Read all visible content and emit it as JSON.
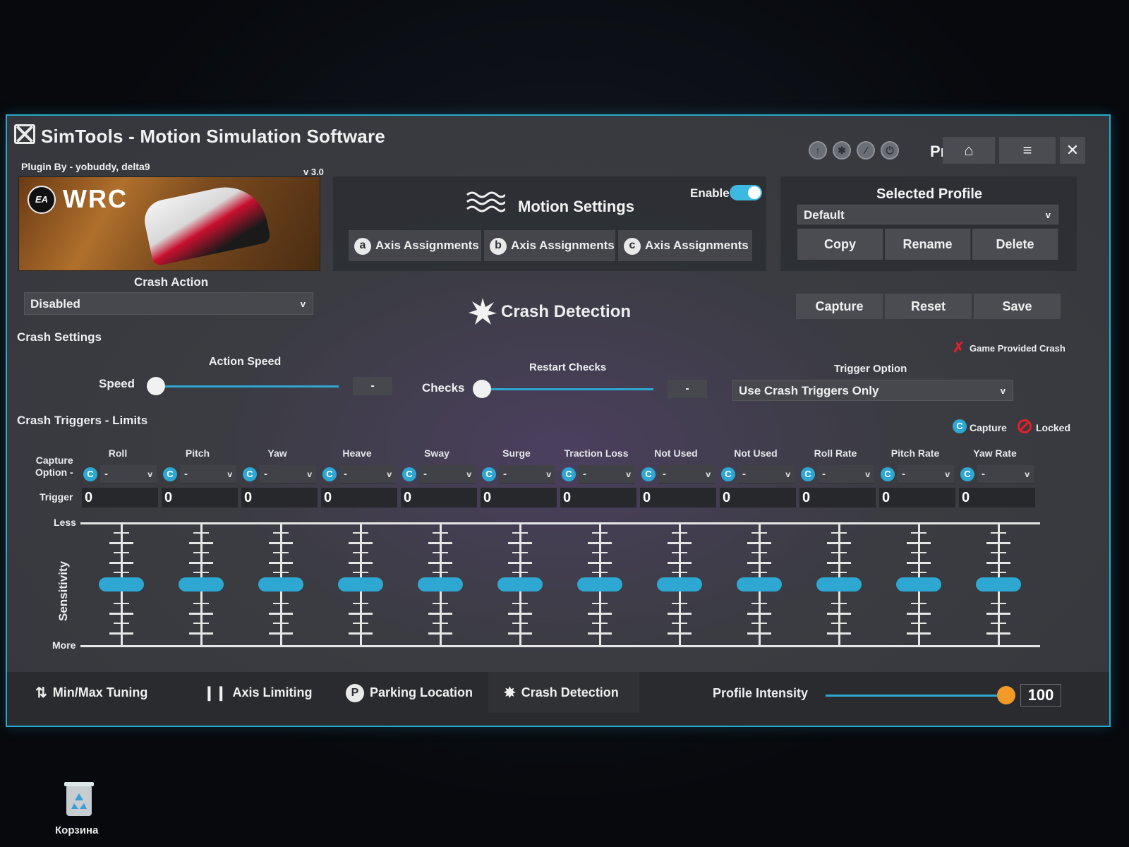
{
  "window": {
    "title": "SimTools - Motion Simulation Software",
    "plugin_by": "Plugin By - yobuddy, delta9",
    "version": "v 3.0",
    "pro_label": "Pro",
    "banner": {
      "ea": "EA",
      "logo": "WRC"
    },
    "titlebar_icons": [
      "arrow-up-icon",
      "gear-icon",
      "wrench-icon",
      "power-icon"
    ],
    "accent_color": "#2ea8d3"
  },
  "motion": {
    "title": "Motion Settings",
    "enable_label": "Enable",
    "enabled": true,
    "tabs": [
      {
        "letter": "a",
        "label": "Axis Assignments"
      },
      {
        "letter": "b",
        "label": "Axis Assignments"
      },
      {
        "letter": "c",
        "label": "Axis Assignments"
      }
    ]
  },
  "profile": {
    "title": "Selected Profile",
    "selected": "Default",
    "buttons": [
      "Copy",
      "Rename",
      "Delete"
    ]
  },
  "crash_action": {
    "label": "Crash Action",
    "value": "Disabled"
  },
  "crash_detection": {
    "title": "Crash Detection",
    "buttons": [
      "Capture",
      "Reset",
      "Save"
    ]
  },
  "crash_settings": {
    "title": "Crash Settings",
    "game_provided": "Game Provided Crash",
    "action_speed_label": "Action Speed",
    "speed_label": "Speed",
    "speed_value": "-",
    "restart_checks_label": "Restart Checks",
    "checks_label": "Checks",
    "checks_value": "-",
    "trigger_option_label": "Trigger Option",
    "trigger_option_value": "Use Crash Triggers Only"
  },
  "crash_triggers": {
    "title": "Crash Triggers - Limits",
    "capture_legend": "Capture",
    "locked_legend": "Locked",
    "capture_option_label": "Capture\nOption -",
    "capture_option_line1": "Capture",
    "capture_option_line2": "Option -",
    "trigger_label": "Trigger",
    "less_label": "Less",
    "more_label": "More",
    "sensitivity_label": "Sensitivity",
    "columns": [
      {
        "name": "Roll",
        "option": "-",
        "trigger": "0"
      },
      {
        "name": "Pitch",
        "option": "-",
        "trigger": "0"
      },
      {
        "name": "Yaw",
        "option": "-",
        "trigger": "0"
      },
      {
        "name": "Heave",
        "option": "-",
        "trigger": "0"
      },
      {
        "name": "Sway",
        "option": "-",
        "trigger": "0"
      },
      {
        "name": "Surge",
        "option": "-",
        "trigger": "0"
      },
      {
        "name": "Traction Loss",
        "option": "-",
        "trigger": "0"
      },
      {
        "name": "Not Used",
        "option": "-",
        "trigger": "0"
      },
      {
        "name": "Not Used",
        "option": "-",
        "trigger": "0"
      },
      {
        "name": "Roll Rate",
        "option": "-",
        "trigger": "0"
      },
      {
        "name": "Pitch Rate",
        "option": "-",
        "trigger": "0"
      },
      {
        "name": "Yaw Rate",
        "option": "-",
        "trigger": "0"
      }
    ]
  },
  "bottom_tabs": [
    {
      "icon": "minmax-arrows-icon",
      "label": "Min/Max Tuning"
    },
    {
      "icon": "axis-bars-icon",
      "label": "Axis Limiting"
    },
    {
      "icon": "parking-icon",
      "label": "Parking Location"
    },
    {
      "icon": "crash-burst-icon",
      "label": "Crash Detection"
    }
  ],
  "profile_intensity": {
    "label": "Profile Intensity",
    "value": "100",
    "level_percent": 100
  },
  "desktop": {
    "recycle_label": "Корзина"
  }
}
